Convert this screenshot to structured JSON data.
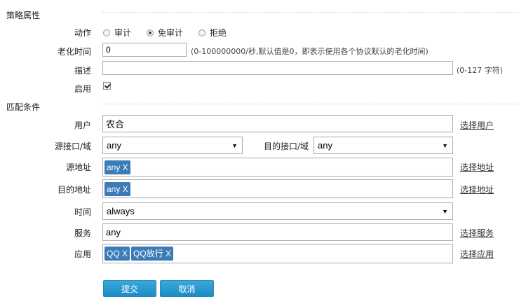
{
  "policy_section": {
    "title": "策略属性"
  },
  "action": {
    "label": "动作",
    "options": [
      "审计",
      "免审计",
      "拒绝"
    ],
    "selected": "免审计"
  },
  "aging": {
    "label": "老化时间",
    "value": "0",
    "hint": "(0-100000000/秒,默认值是0，即表示使用各个协议默认的老化时间)"
  },
  "description": {
    "label": "描述",
    "value": "",
    "hint": "(0-127 字符)"
  },
  "enable": {
    "label": "启用",
    "checked": true
  },
  "match_section": {
    "title": "匹配条件"
  },
  "user": {
    "label": "用户",
    "value": "农合",
    "link": "选择用户"
  },
  "src_interface": {
    "label": "源接口/域",
    "value": "any"
  },
  "dst_interface": {
    "label": "目的接口/域",
    "value": "any"
  },
  "src_address": {
    "label": "源地址",
    "tags": [
      "any X"
    ],
    "link": "选择地址"
  },
  "dst_address": {
    "label": "目的地址",
    "tags": [
      "any X"
    ],
    "link": "选择地址"
  },
  "time": {
    "label": "时间",
    "value": "always"
  },
  "service": {
    "label": "服务",
    "value": "any",
    "link": "选择服务"
  },
  "application": {
    "label": "应用",
    "tags": [
      "QQ X",
      "QQ放行 X"
    ],
    "link": "选择应用"
  },
  "buttons": {
    "submit": "提交",
    "cancel": "取消"
  },
  "colors": {
    "tag_bg": "#3b7cb8",
    "button_bg": "#1c8cc6"
  }
}
